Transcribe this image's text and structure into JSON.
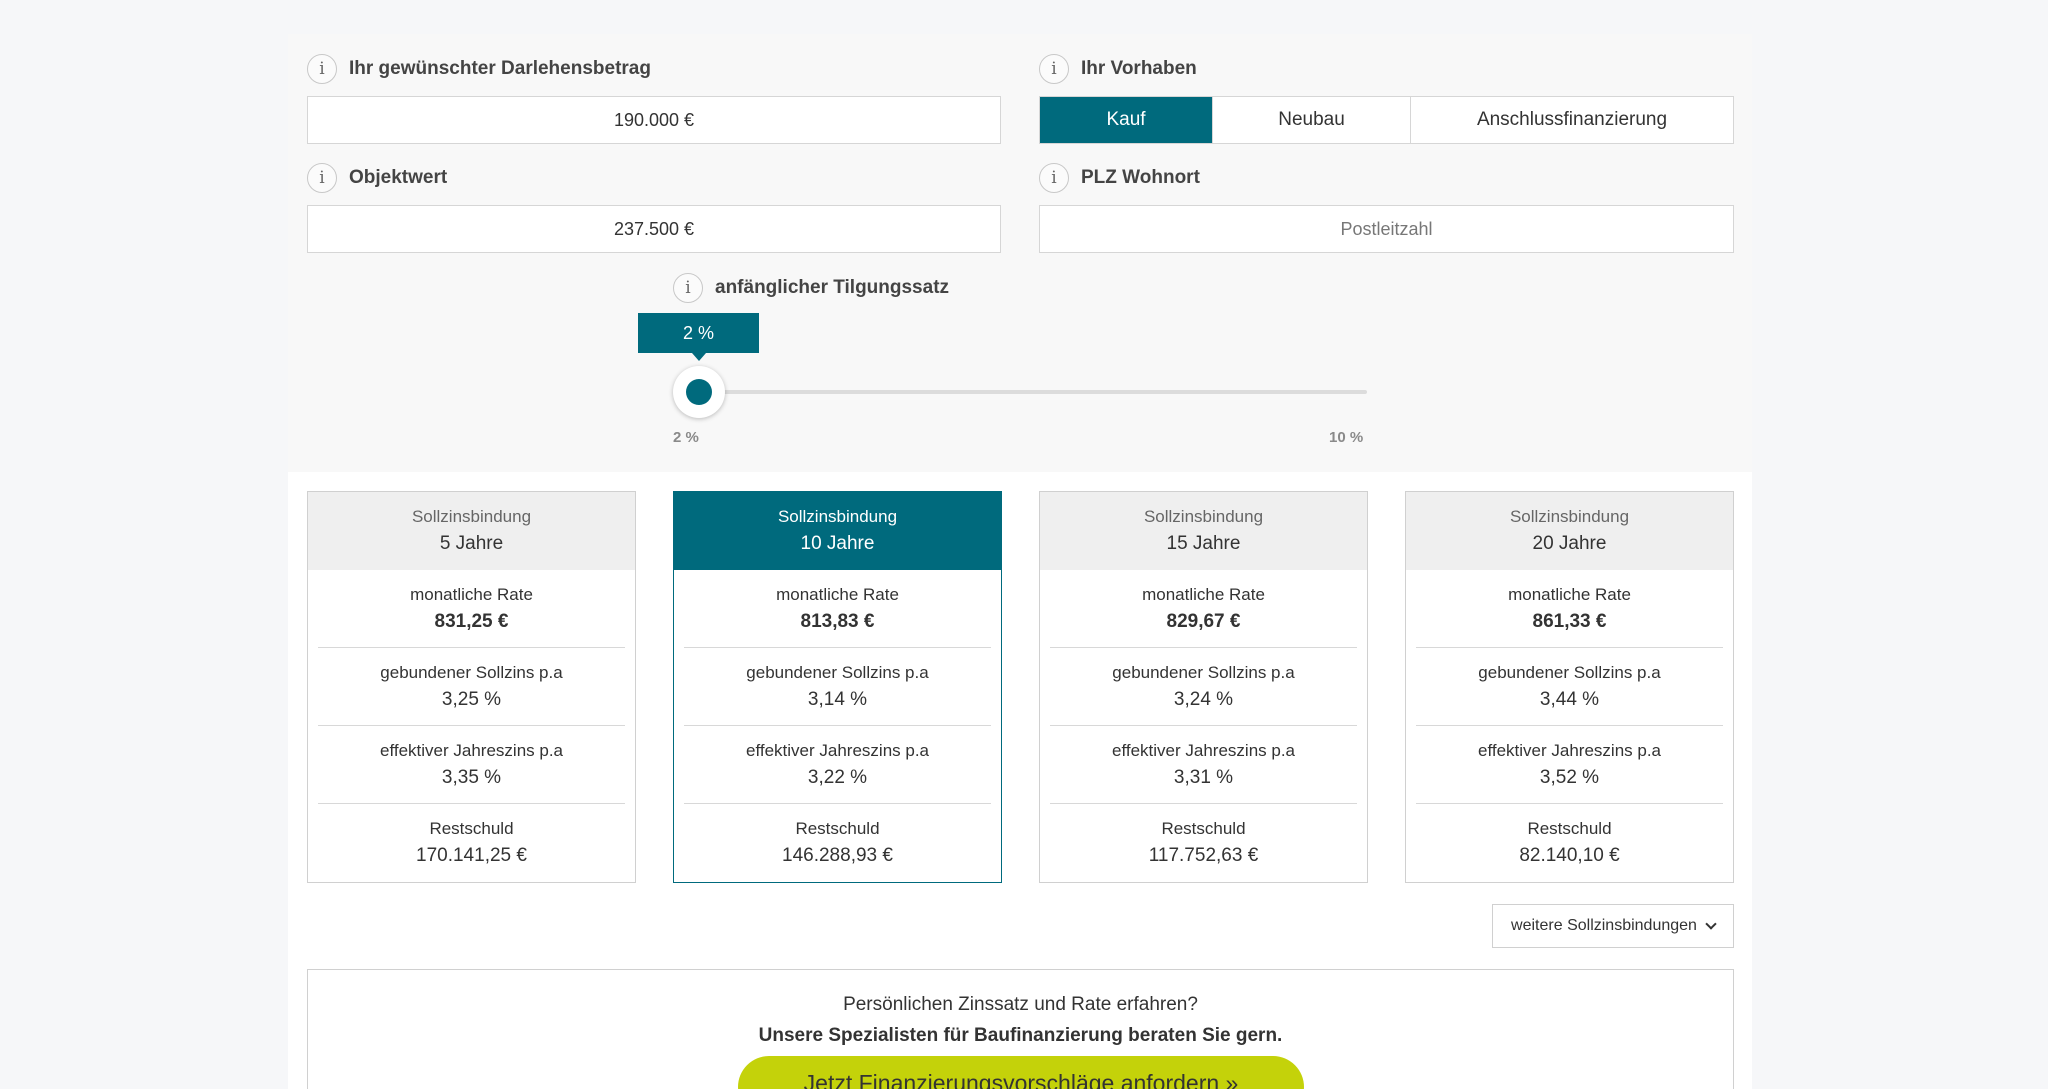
{
  "loan_amount": {
    "label": "Ihr gewünschter Darlehensbetrag",
    "value": "190.000 €"
  },
  "purpose": {
    "label": "Ihr Vorhaben",
    "options": [
      "Kauf",
      "Neubau",
      "Anschlussfinanzierung"
    ],
    "selected": "Kauf"
  },
  "property_value": {
    "label": "Objektwert",
    "value": "237.500 €"
  },
  "postal_code": {
    "label": "PLZ Wohnort",
    "placeholder": "Postleitzahl",
    "value": ""
  },
  "repayment": {
    "label": "anfänglicher Tilgungssatz",
    "current": "2 %",
    "min_label": "2 %",
    "max_label": "10 %",
    "value": 2,
    "min": 2,
    "max": 10
  },
  "offers": [
    {
      "head_label": "Sollzinsbindung",
      "term": "5 Jahre",
      "active": false,
      "rate_label": "monatliche Rate",
      "rate": "831,25 €",
      "interest_label": "gebundener Sollzins p.a",
      "interest": "3,25 %",
      "effective_label": "effektiver Jahreszins p.a",
      "effective": "3,35 %",
      "remaining_label": "Restschuld",
      "remaining": "170.141,25 €"
    },
    {
      "head_label": "Sollzinsbindung",
      "term": "10 Jahre",
      "active": true,
      "rate_label": "monatliche Rate",
      "rate": "813,83 €",
      "interest_label": "gebundener Sollzins p.a",
      "interest": "3,14 %",
      "effective_label": "effektiver Jahreszins p.a",
      "effective": "3,22 %",
      "remaining_label": "Restschuld",
      "remaining": "146.288,93 €"
    },
    {
      "head_label": "Sollzinsbindung",
      "term": "15 Jahre",
      "active": false,
      "rate_label": "monatliche Rate",
      "rate": "829,67 €",
      "interest_label": "gebundener Sollzins p.a",
      "interest": "3,24 %",
      "effective_label": "effektiver Jahreszins p.a",
      "effective": "3,31 %",
      "remaining_label": "Restschuld",
      "remaining": "117.752,63 €"
    },
    {
      "head_label": "Sollzinsbindung",
      "term": "20 Jahre",
      "active": false,
      "rate_label": "monatliche Rate",
      "rate": "861,33 €",
      "interest_label": "gebundener Sollzins p.a",
      "interest": "3,44 %",
      "effective_label": "effektiver Jahreszins p.a",
      "effective": "3,52 %",
      "remaining_label": "Restschuld",
      "remaining": "82.140,10 €"
    }
  ],
  "more_terms_label": "weitere Sollzinsbindungen",
  "cta": {
    "line1": "Persönlichen Zinssatz und Rate erfahren?",
    "line2": "Unsere Spezialisten für Baufinanzierung beraten Sie gern.",
    "button": "Jetzt Finanzierungsvorschläge anfordern »"
  },
  "colors": {
    "accent": "#006a7d",
    "cta": "#c4d20a",
    "panel_bg": "#f8f8f8"
  },
  "icons": {
    "info": "info-icon",
    "dropdown": "chevron-down-icon"
  }
}
